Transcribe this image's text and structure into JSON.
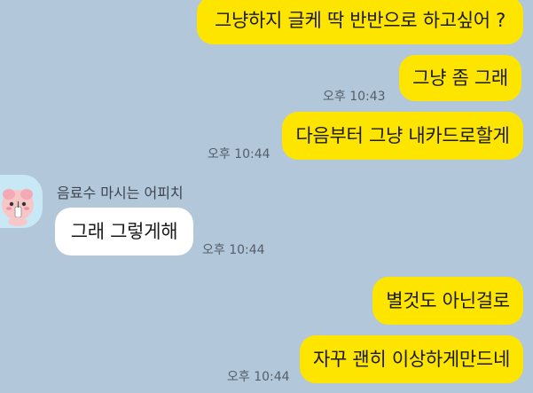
{
  "chat": {
    "sender_name": "음료수 마시는 어피치",
    "messages": [
      {
        "from": "me",
        "text": "그냥하지 글케 딱 반반으로 하고싶어 ?"
      },
      {
        "from": "me",
        "text": "그냥 좀 그래",
        "time": "오후 10:43"
      },
      {
        "from": "me",
        "text": "다음부터 그냥 내카드로할게",
        "time": "오후 10:44"
      },
      {
        "from": "them",
        "text": "그래 그렇게해",
        "time": "오후 10:44"
      },
      {
        "from": "me",
        "text": "별것도 아닌걸로"
      },
      {
        "from": "me",
        "text": "자꾸 괜히 이상하게만드네",
        "time": "오후 10:44"
      }
    ]
  },
  "colors": {
    "background": "#b2c7da",
    "my_bubble": "#fee500",
    "their_bubble": "#ffffff"
  },
  "icons": {
    "avatar": "apeach-drinking-avatar"
  }
}
